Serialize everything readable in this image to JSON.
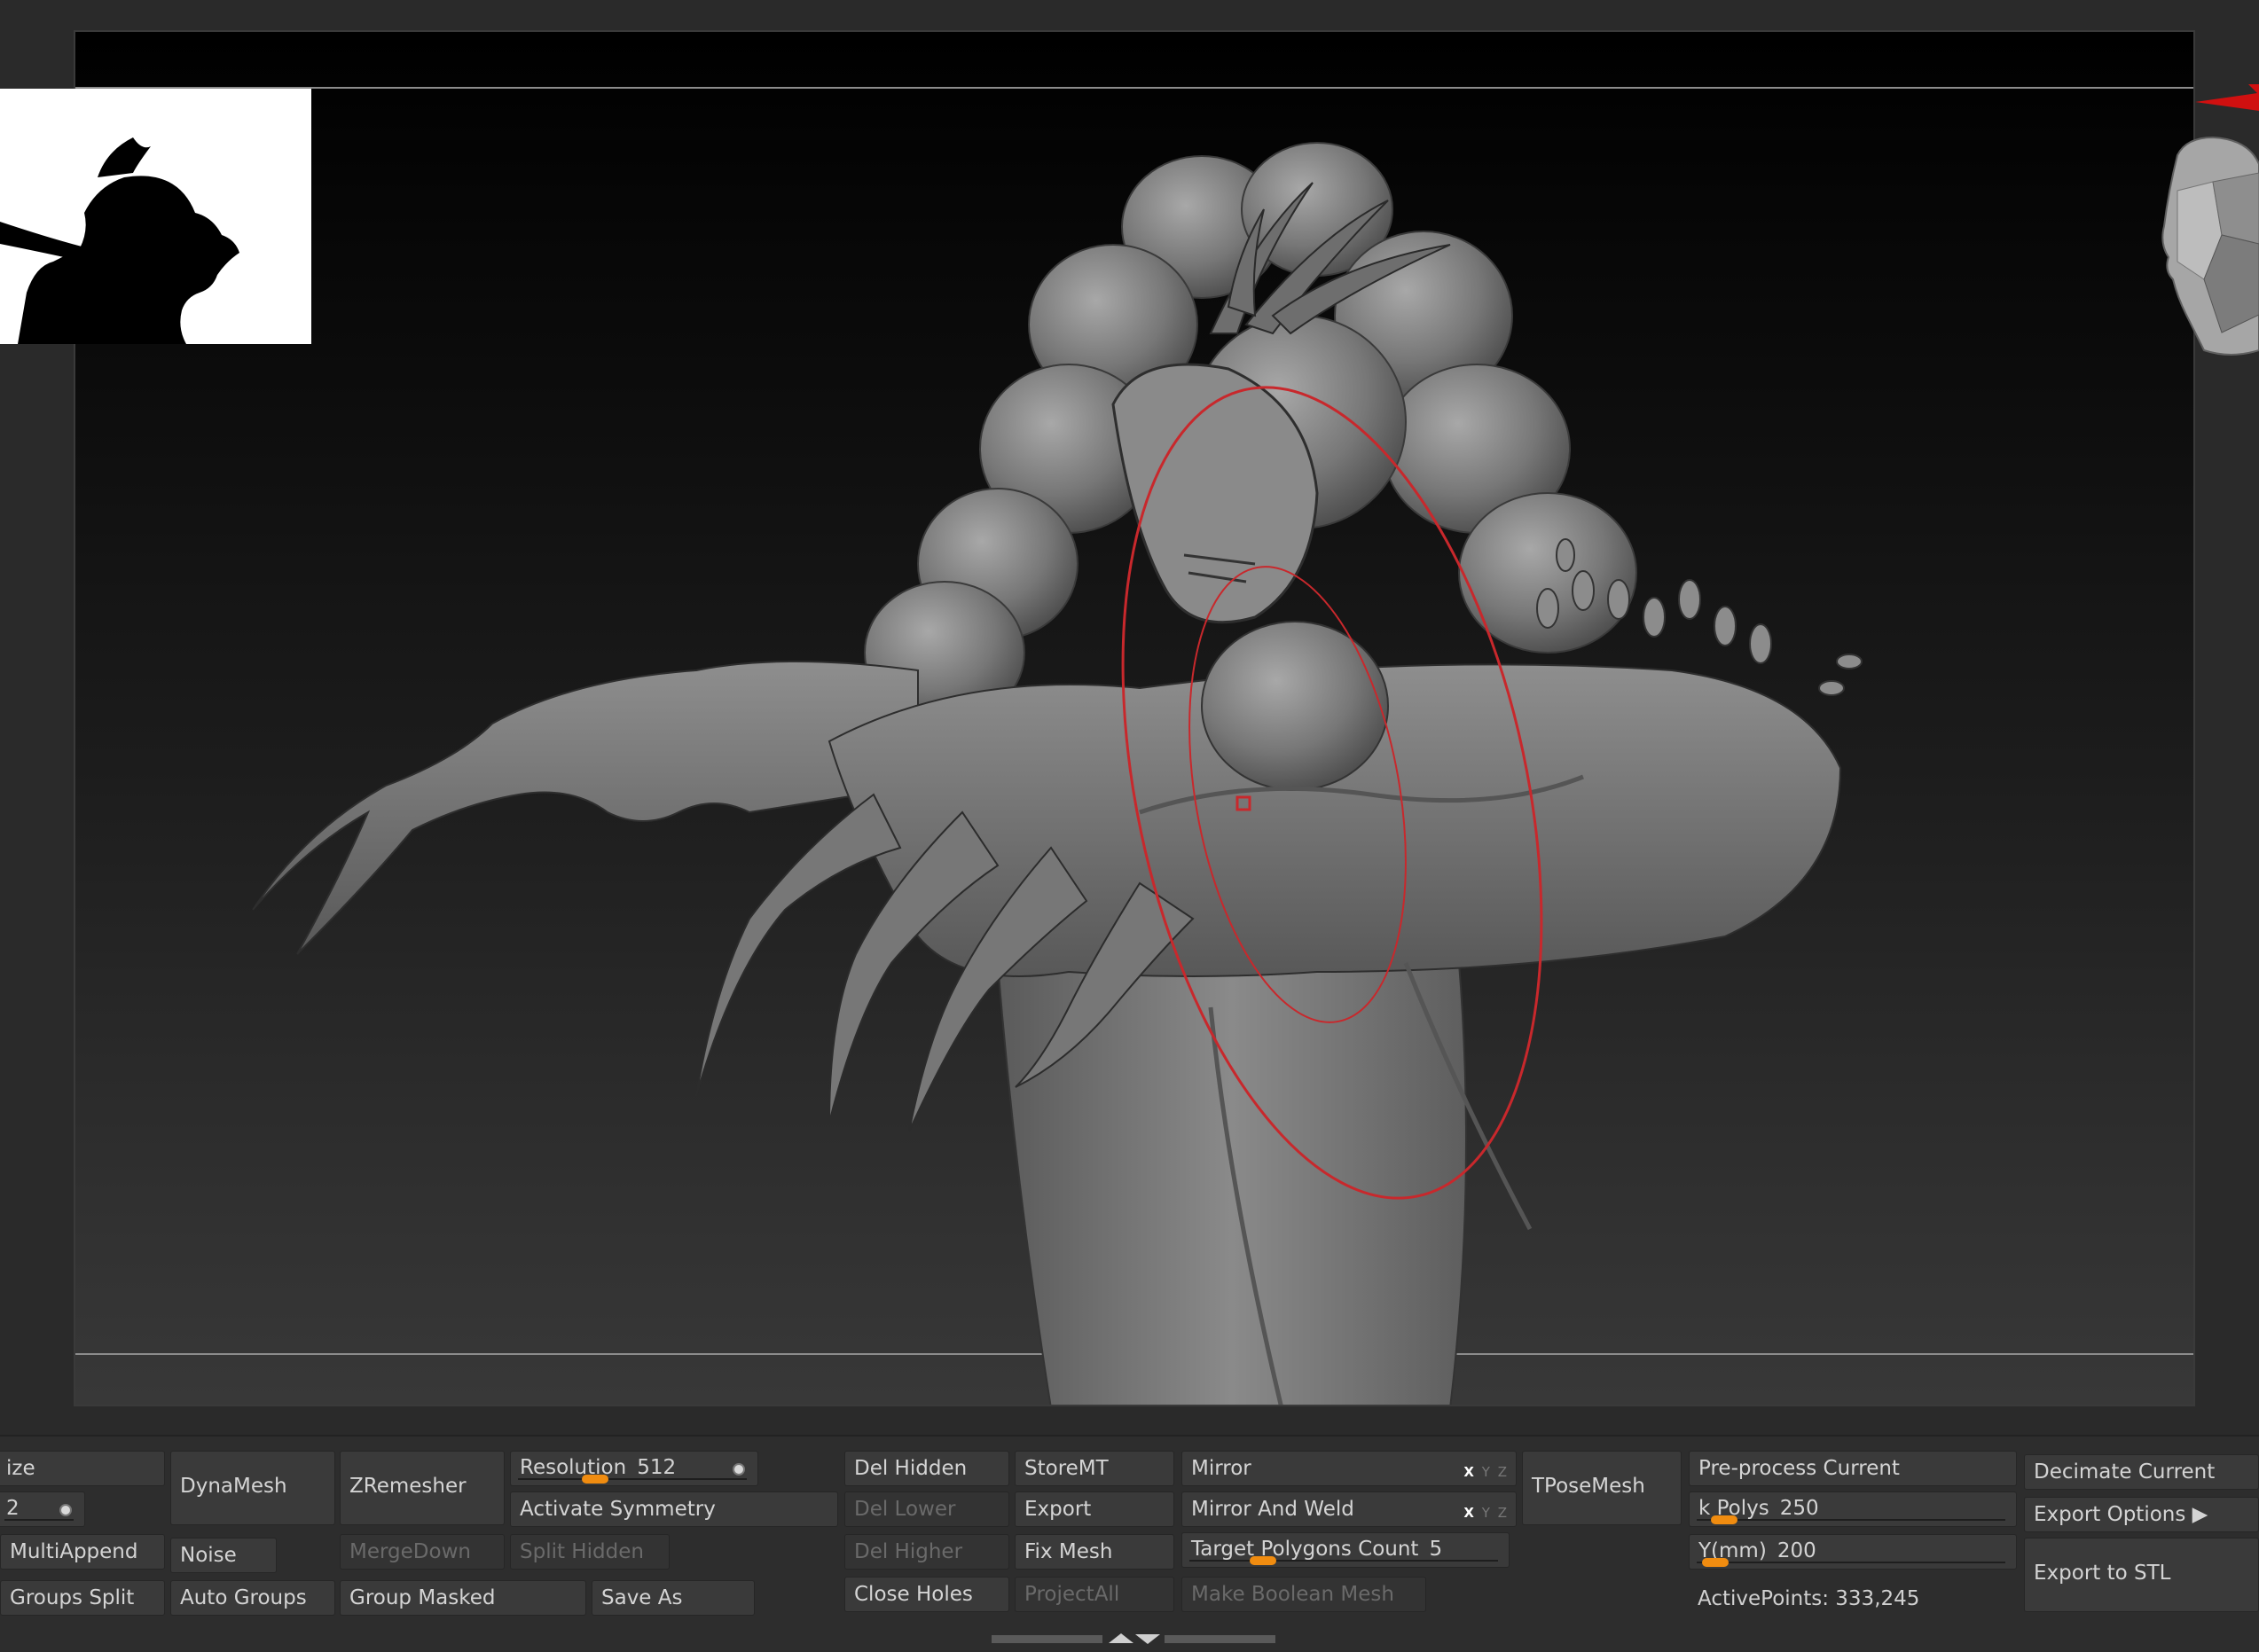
{
  "panel": {
    "col1": {
      "size_label": "ize",
      "size_value": "2",
      "multiappend": "MultiAppend",
      "groups_split": "Groups Split"
    },
    "col2": {
      "dynamesh": "DynaMesh",
      "noise": "Noise",
      "auto_groups": "Auto Groups"
    },
    "col3": {
      "zremesher": "ZRemesher",
      "mergedown": "MergeDown",
      "group_masked": "Group Masked"
    },
    "col4": {
      "resolution_label": "Resolution",
      "resolution_value": "512",
      "resolution_fraction": 0.3,
      "activate_symmetry": "Activate Symmetry",
      "split_hidden": "Split Hidden",
      "save_as": "Save As"
    },
    "col5": {
      "del_hidden": "Del Hidden",
      "del_lower": "Del Lower",
      "del_higher": "Del Higher",
      "close_holes": "Close Holes"
    },
    "col6": {
      "storemt": "StoreMT",
      "export": "Export",
      "fix_mesh": "Fix Mesh",
      "projectall": "ProjectAll"
    },
    "col7": {
      "mirror": "Mirror",
      "mirror_and_weld": "Mirror And Weld",
      "target_label": "Target Polygons Count",
      "target_value": "5",
      "target_fraction": 0.25,
      "make_boolean_mesh": "Make Boolean Mesh",
      "xyz": [
        "X",
        "Y",
        "Z"
      ]
    },
    "col8": {
      "tposemesh": "TPoseMesh"
    },
    "col9": {
      "preprocess": "Pre-process Current",
      "kpolys_label": "k Polys",
      "kpolys_value": "250",
      "kpolys_fraction": 0.1,
      "ymm_label": "Y(mm)",
      "ymm_value": "200",
      "ymm_fraction": 0.08,
      "active_points": "ActivePoints: 333,245"
    },
    "col10": {
      "decimate_current": "Decimate Current",
      "export_options": "Export Options ▶",
      "export_stl": "Export to STL"
    }
  },
  "colors": {
    "slider_knob": "#f08c10",
    "brush_ring": "#c8282c",
    "model_gray": "#7a7a7a"
  }
}
